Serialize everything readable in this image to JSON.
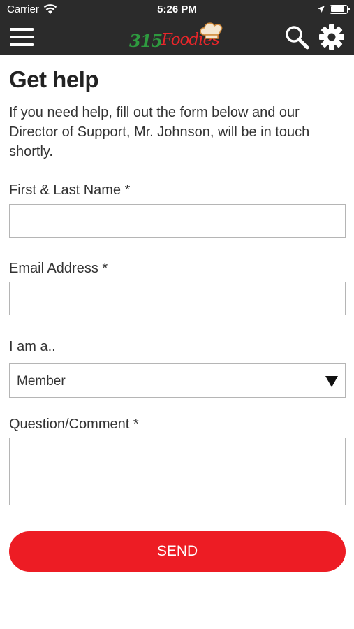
{
  "status_bar": {
    "carrier": "Carrier",
    "time": "5:26 PM"
  },
  "header": {
    "logo_number": "315",
    "logo_word": "Foodies",
    "background": "#2b2b2b",
    "icons": [
      "menu-icon",
      "search-icon",
      "gear-icon"
    ]
  },
  "page": {
    "title": "Get help",
    "intro": "If you need help, fill out the form below and our Director of Support, Mr. Johnson, will be in touch shortly."
  },
  "form": {
    "name_label": "First & Last Name *",
    "name_value": "",
    "email_label": "Email Address *",
    "email_value": "",
    "role_label": "I am a..",
    "role_selected": "Member",
    "comment_label": "Question/Comment *",
    "comment_value": "",
    "send_label": "SEND",
    "accent": "#ed1c24"
  }
}
